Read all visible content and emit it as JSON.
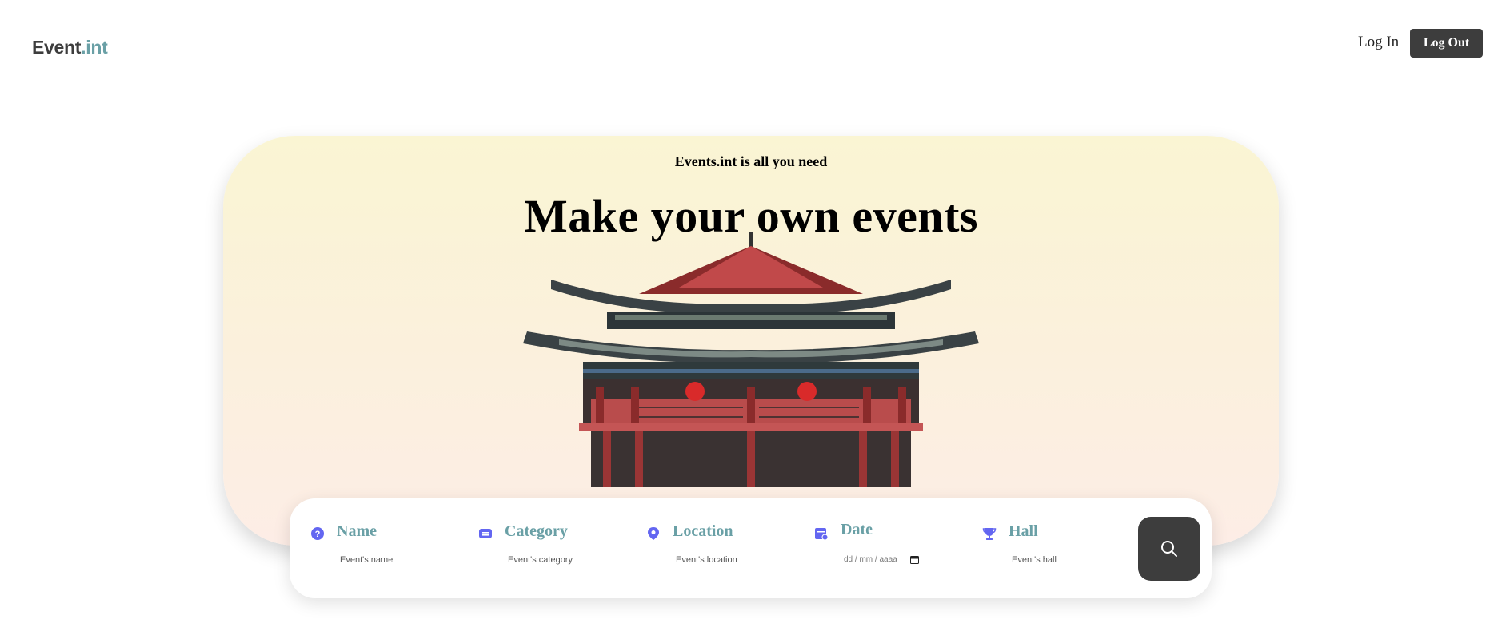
{
  "header": {
    "logo_main": "Event",
    "logo_accent": ".int",
    "login_label": "Log In",
    "logout_label": "Log Out"
  },
  "hero": {
    "subtitle": "Events.int is all you need",
    "title": "Make your own events"
  },
  "search": {
    "fields": [
      {
        "label": "Name",
        "placeholder": "Event's name",
        "icon": "question-icon"
      },
      {
        "label": "Category",
        "placeholder": "Event's category",
        "icon": "category-icon"
      },
      {
        "label": "Location",
        "placeholder": "Event's location",
        "icon": "location-icon"
      },
      {
        "label": "Date",
        "placeholder": "dd / mm / aaaa",
        "icon": "calendar-icon"
      },
      {
        "label": "Hall",
        "placeholder": "Event's hall",
        "icon": "trophy-icon"
      }
    ],
    "button_icon": "search-icon"
  },
  "colors": {
    "accent": "#6aa0a6",
    "dark": "#3d3d3d",
    "icon": "#6366f1"
  }
}
